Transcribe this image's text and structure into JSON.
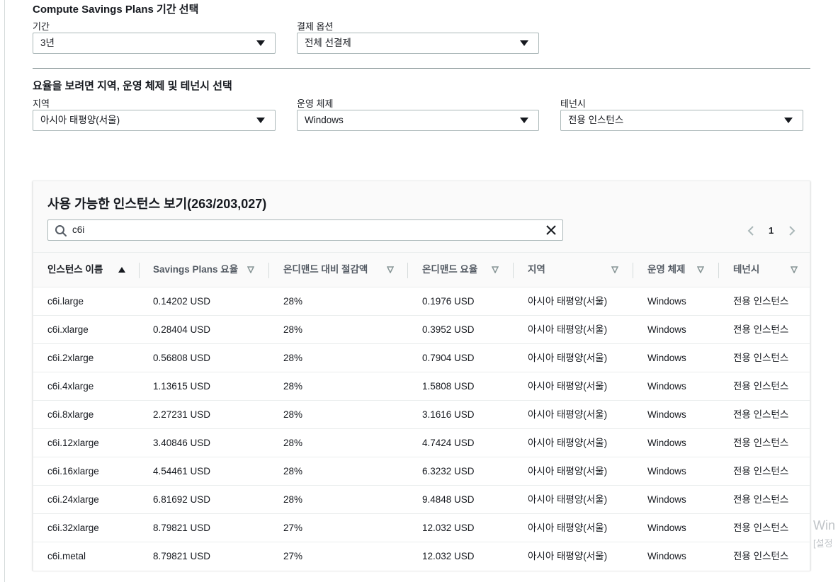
{
  "term_section": {
    "title": "Compute Savings Plans 기간 선택",
    "term_label": "기간",
    "term_value": "3년",
    "payment_label": "결제 옵션",
    "payment_value": "전체 선결제"
  },
  "filter_section": {
    "title": "요율을 보려면 지역, 운영 체제 및 테넌시 선택",
    "region_label": "지역",
    "region_value": "아시아 태평양(서울)",
    "os_label": "운영 체제",
    "os_value": "Windows",
    "tenancy_label": "테넌시",
    "tenancy_value": "전용 인스턴스"
  },
  "table": {
    "title": "사용 가능한 인스턴스 보기(263/203,027)",
    "search_value": "c6i",
    "current_page": "1",
    "columns": [
      "인스턴스 이름",
      "Savings Plans 요율",
      "온디맨드 대비 절감액",
      "온디맨드 요율",
      "지역",
      "운영 체제",
      "테넌시"
    ],
    "sorted_column_index": 0,
    "rows": [
      [
        "c6i.large",
        "0.14202 USD",
        "28%",
        "0.1976 USD",
        "아시아 태평양(서울)",
        "Windows",
        "전용 인스턴스"
      ],
      [
        "c6i.xlarge",
        "0.28404 USD",
        "28%",
        "0.3952 USD",
        "아시아 태평양(서울)",
        "Windows",
        "전용 인스턴스"
      ],
      [
        "c6i.2xlarge",
        "0.56808 USD",
        "28%",
        "0.7904 USD",
        "아시아 태평양(서울)",
        "Windows",
        "전용 인스턴스"
      ],
      [
        "c6i.4xlarge",
        "1.13615 USD",
        "28%",
        "1.5808 USD",
        "아시아 태평양(서울)",
        "Windows",
        "전용 인스턴스"
      ],
      [
        "c6i.8xlarge",
        "2.27231 USD",
        "28%",
        "3.1616 USD",
        "아시아 태평양(서울)",
        "Windows",
        "전용 인스턴스"
      ],
      [
        "c6i.12xlarge",
        "3.40846 USD",
        "28%",
        "4.7424 USD",
        "아시아 태평양(서울)",
        "Windows",
        "전용 인스턴스"
      ],
      [
        "c6i.16xlarge",
        "4.54461 USD",
        "28%",
        "6.3232 USD",
        "아시아 태평양(서울)",
        "Windows",
        "전용 인스턴스"
      ],
      [
        "c6i.24xlarge",
        "6.81692 USD",
        "28%",
        "9.4848 USD",
        "아시아 태평양(서울)",
        "Windows",
        "전용 인스턴스"
      ],
      [
        "c6i.32xlarge",
        "8.79821 USD",
        "27%",
        "12.032 USD",
        "아시아 태평양(서울)",
        "Windows",
        "전용 인스턴스"
      ],
      [
        "c6i.metal",
        "8.79821 USD",
        "27%",
        "12.032 USD",
        "아시아 태평양(서울)",
        "Windows",
        "전용 인스턴스"
      ]
    ]
  },
  "watermark": {
    "line1": "Win",
    "line2": "[설정"
  }
}
